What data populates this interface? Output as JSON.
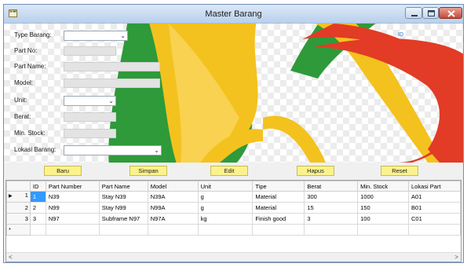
{
  "window": {
    "title": "Master Barang"
  },
  "form": {
    "type_barang": {
      "label": "Type Barang:",
      "value": ""
    },
    "part_no": {
      "label": "Part No:",
      "value": ""
    },
    "part_name": {
      "label": "Part Name:",
      "value": ""
    },
    "model": {
      "label": "Model:",
      "value": ""
    },
    "unit": {
      "label": "Unit:",
      "value": ""
    },
    "berat": {
      "label": "Berat:",
      "value": ""
    },
    "min_stock": {
      "label": "Min. Stock:",
      "value": ""
    },
    "lokasi_barang": {
      "label": "Lokasi Barang:",
      "value": ""
    },
    "id_label": "ID"
  },
  "buttons": {
    "baru": "Baru",
    "simpan": "Simpan",
    "edit": "Edit",
    "hapus": "Hapus",
    "reset": "Reset"
  },
  "grid": {
    "columns": [
      "ID",
      "Part Number",
      "Part Name",
      "Model",
      "Unit",
      "Tipe",
      "Berat",
      "Min. Stock",
      "Lokasi Part"
    ],
    "rows": [
      {
        "num": "1",
        "cells": [
          "1",
          "N39",
          "Stay N39",
          "N39A",
          "g",
          "Material",
          "300",
          "1000",
          "A01"
        ]
      },
      {
        "num": "2",
        "cells": [
          "2",
          "N99",
          "Stay N99",
          "N99A",
          "g",
          "Material",
          "15",
          "150",
          "B01"
        ]
      },
      {
        "num": "3",
        "cells": [
          "3",
          "N97",
          "Subframe N97",
          "N97A",
          "kg",
          "Finish good",
          "3",
          "100",
          "C01"
        ]
      }
    ],
    "new_row_marker": "*",
    "current_row_marker": "▶"
  },
  "colors": {
    "accent_yellow": "#fbf28c",
    "selection": "#3399ff"
  }
}
